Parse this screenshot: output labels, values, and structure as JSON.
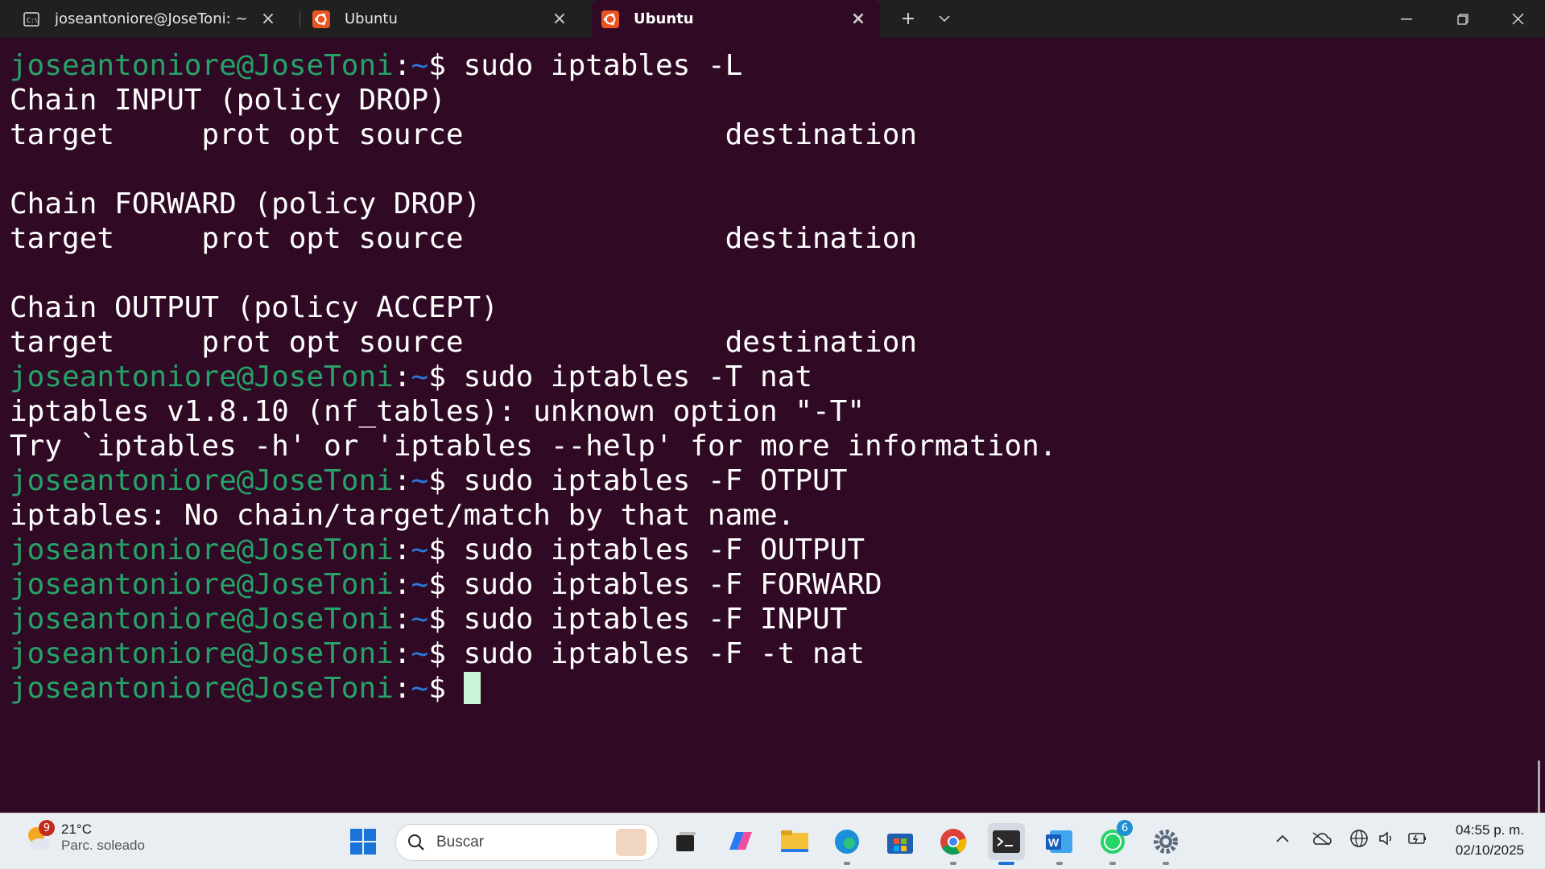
{
  "tabs": [
    {
      "title": "joseantoniore@JoseToni: ~",
      "icon": "command-prompt-icon",
      "active": false
    },
    {
      "title": "Ubuntu",
      "icon": "ubuntu-icon",
      "active": false
    },
    {
      "title": "Ubuntu",
      "icon": "ubuntu-icon",
      "active": true
    }
  ],
  "titlebar": {
    "new_tab": "+",
    "dropdown": "⌄",
    "minimize": "—",
    "restore": "❐",
    "close": "✕"
  },
  "terminal": {
    "prompt": {
      "user": "joseantoniore@JoseToni",
      "colon": ":",
      "path": "~",
      "dollar": "$ "
    },
    "lines": [
      {
        "type": "cmd",
        "text": "sudo iptables -L"
      },
      {
        "type": "out",
        "text": "Chain INPUT (policy DROP)"
      },
      {
        "type": "out",
        "text": "target     prot opt source               destination"
      },
      {
        "type": "out",
        "text": ""
      },
      {
        "type": "out",
        "text": "Chain FORWARD (policy DROP)"
      },
      {
        "type": "out",
        "text": "target     prot opt source               destination"
      },
      {
        "type": "out",
        "text": ""
      },
      {
        "type": "out",
        "text": "Chain OUTPUT (policy ACCEPT)"
      },
      {
        "type": "out",
        "text": "target     prot opt source               destination"
      },
      {
        "type": "cmd",
        "text": "sudo iptables -T nat"
      },
      {
        "type": "out",
        "text": "iptables v1.8.10 (nf_tables): unknown option \"-T\""
      },
      {
        "type": "out",
        "text": "Try `iptables -h' or 'iptables --help' for more information."
      },
      {
        "type": "cmd",
        "text": "sudo iptables -F OTPUT"
      },
      {
        "type": "out",
        "text": "iptables: No chain/target/match by that name."
      },
      {
        "type": "cmd",
        "text": "sudo iptables -F OUTPUT"
      },
      {
        "type": "cmd",
        "text": "sudo iptables -F FORWARD"
      },
      {
        "type": "cmd",
        "text": "sudo iptables -F INPUT"
      },
      {
        "type": "cmd",
        "text": "sudo iptables -F -t nat"
      },
      {
        "type": "cmd",
        "text": "",
        "cursor": true
      }
    ]
  },
  "taskbar": {
    "weather": {
      "badge": "9",
      "temp": "21°C",
      "condition": "Parc. soleado"
    },
    "search_placeholder": "Buscar",
    "apps": [
      {
        "name": "start-icon"
      },
      {
        "name": "task-view-icon"
      },
      {
        "name": "copilot-icon"
      },
      {
        "name": "file-explorer-icon"
      },
      {
        "name": "edge-icon"
      },
      {
        "name": "microsoft-store-icon"
      },
      {
        "name": "chrome-icon"
      },
      {
        "name": "terminal-icon"
      },
      {
        "name": "word-icon"
      },
      {
        "name": "whatsapp-icon",
        "badge": "6"
      },
      {
        "name": "settings-icon"
      }
    ],
    "clock": {
      "time": "04:55 p. m.",
      "date": "02/10/2025"
    }
  },
  "colors": {
    "terminal_bg": "#300a24",
    "prompt_user": "#26a269",
    "prompt_path": "#2a7bde",
    "cursor": "#c8f5d5"
  }
}
